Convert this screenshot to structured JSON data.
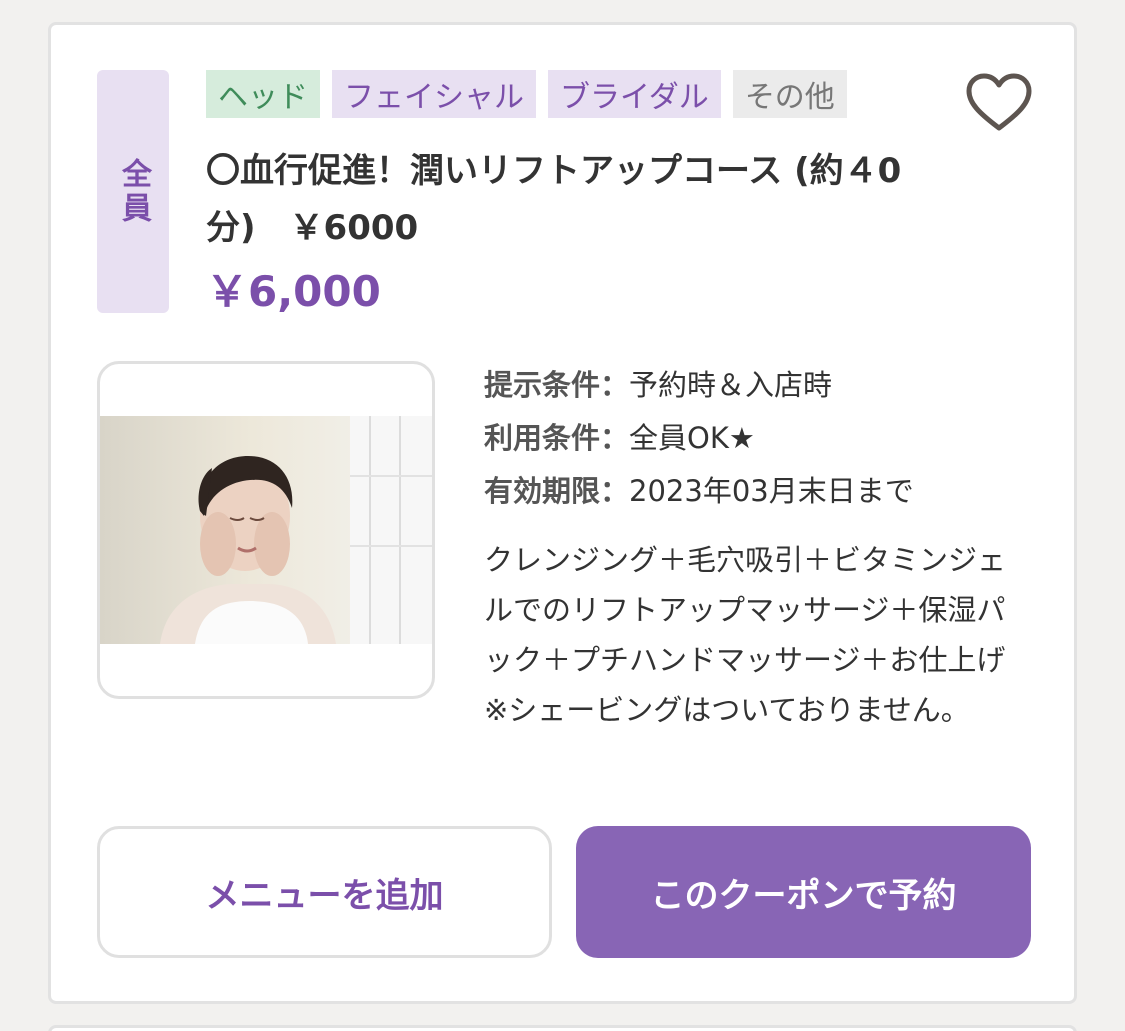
{
  "coupon": {
    "target": "全員",
    "tags": [
      {
        "label": "ヘッド",
        "color": "#d6ecdc"
      },
      {
        "label": "フェイシャル",
        "color": "#e8e0f2"
      },
      {
        "label": "ブライダル",
        "color": "#e8e0f2"
      },
      {
        "label": "その他",
        "color": "#ebebeb"
      }
    ],
    "favorite_icon": "heart-outline-icon",
    "title": "〇血行促進！潤いリフトアップコース (約４0分)　￥6000",
    "price": "￥6,000",
    "conditions": [
      {
        "label": "提示条件：",
        "value": "予約時＆入店時"
      },
      {
        "label": "利用条件：",
        "value": "全員OK★"
      },
      {
        "label": "有効期限：",
        "value": "2023年03月末日まで"
      }
    ],
    "description": "クレンジング＋毛穴吸引＋ビタミンジェルでのリフトアップマッサージ＋保湿パック＋プチハンドマッサージ＋お仕上げ　　※シェービングはついておりません。",
    "buttons": {
      "add_menu": "メニューを追加",
      "reserve": "このクーポンで予約"
    },
    "colors": {
      "accent": "#7b4faa",
      "button_primary": "#8865b5"
    }
  }
}
